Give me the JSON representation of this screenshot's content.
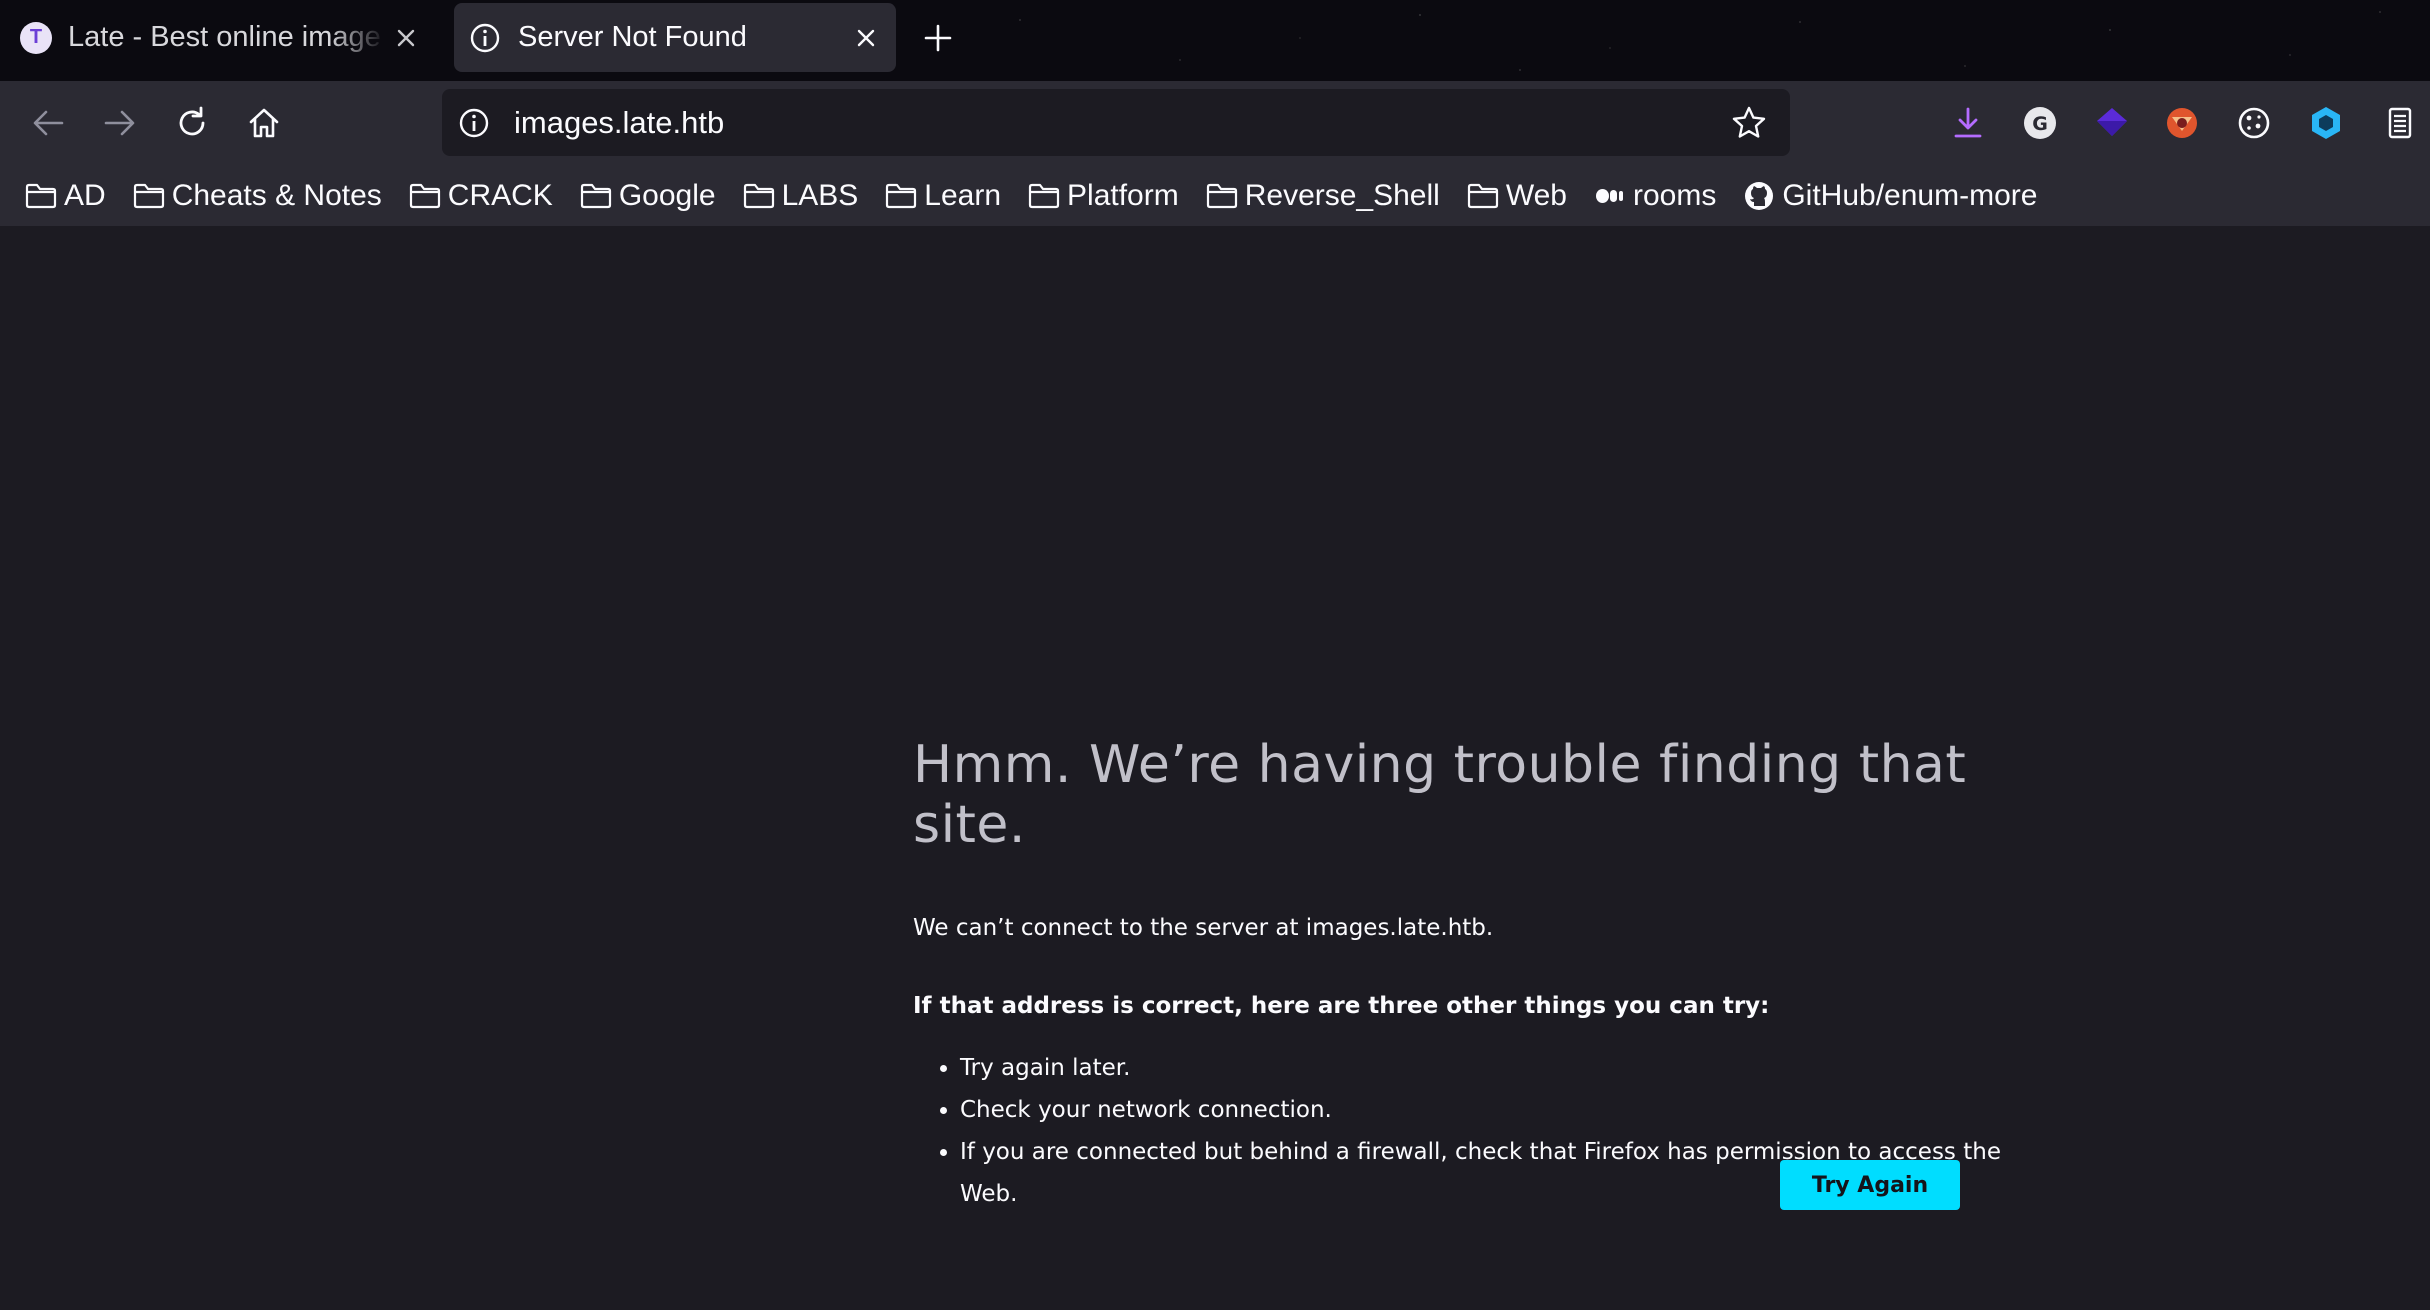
{
  "tabs": [
    {
      "favicon_letter": "T",
      "title": "Late - Best online image t"
    },
    {
      "title": "Server Not Found"
    }
  ],
  "navbar": {
    "url": "images.late.htb",
    "extensions": [
      "download-icon",
      "grammarly-icon",
      "purple-gem-icon",
      "wappalyzer-icon",
      "cookie-icon",
      "hex-cube-icon",
      "reader-list-icon"
    ]
  },
  "bookmarks": [
    {
      "label": "AD",
      "icon": "folder-icon"
    },
    {
      "label": "Cheats & Notes",
      "icon": "folder-icon"
    },
    {
      "label": "CRACK",
      "icon": "folder-icon"
    },
    {
      "label": "Google",
      "icon": "folder-icon"
    },
    {
      "label": "LABS",
      "icon": "folder-icon"
    },
    {
      "label": "Learn",
      "icon": "folder-icon"
    },
    {
      "label": "Platform",
      "icon": "folder-icon"
    },
    {
      "label": "Reverse_Shell",
      "icon": "folder-icon"
    },
    {
      "label": "Web",
      "icon": "folder-icon"
    },
    {
      "label": "rooms",
      "icon": "rooms-icon"
    },
    {
      "label": "GitHub/enum-more",
      "icon": "github-icon"
    }
  ],
  "error": {
    "title": "Hmm. We’re having trouble finding that site.",
    "description": "We can’t connect to the server at images.late.htb.",
    "hint": "If that address is correct, here are three other things you can try:",
    "suggestions": [
      "Try again later.",
      "Check your network connection.",
      "If you are connected but behind a firewall, check that Firefox has permission to access the Web."
    ],
    "button_label": "Try Again"
  },
  "colors": {
    "page_bg": "#1c1b22",
    "toolbar_bg": "#2b2a33",
    "accent_button": "#00ddff"
  }
}
